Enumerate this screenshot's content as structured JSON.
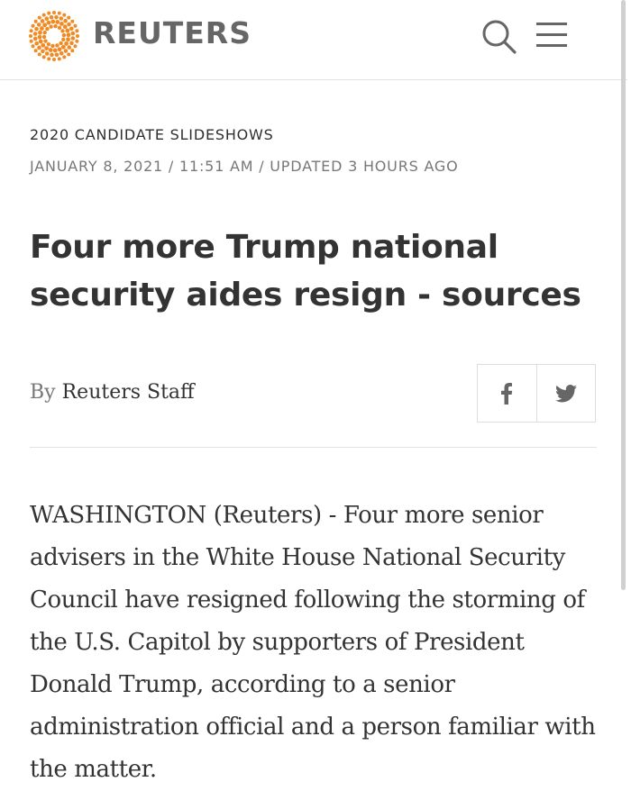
{
  "header": {
    "logo_text": "REUTERS",
    "logo_icon": "reuters-dot-sphere-logo",
    "search_icon": "search-icon",
    "menu_icon": "hamburger-menu-icon"
  },
  "article": {
    "section": "2020 CANDIDATE SLIDESHOWS",
    "dateline": "JANUARY 8, 2021 / 11:51 AM / UPDATED 3 HOURS AGO",
    "headline": "Four more Trump national security aides resign - sources",
    "byline_prefix": "By",
    "byline_author": "Reuters Staff",
    "share": {
      "facebook_icon": "facebook-icon",
      "twitter_icon": "twitter-icon"
    },
    "body": "WASHINGTON (Reuters) - Four more senior advisers in the White House National Security Council have resigned following the storming of the U.S. Capitol by supporters of President Donald Trump, according to a senior administration official and a person familiar with the matter."
  },
  "colors": {
    "logo_orange": "#f08a24",
    "text_dark": "#333333",
    "text_muted": "#777777",
    "divider": "#e2e2e2"
  }
}
